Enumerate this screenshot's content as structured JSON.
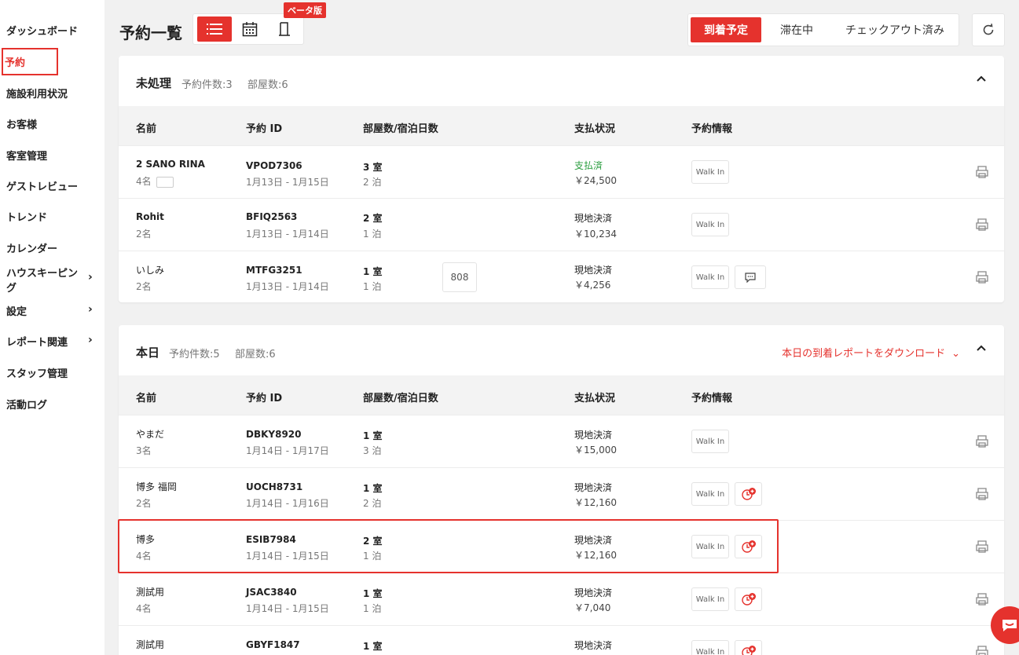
{
  "sidebar": {
    "items": [
      {
        "label": "ダッシュボード"
      },
      {
        "label": "予約"
      },
      {
        "label": "施設利用状況"
      },
      {
        "label": "お客様"
      },
      {
        "label": "客室管理"
      },
      {
        "label": "ゲストレビュー"
      },
      {
        "label": "トレンド"
      },
      {
        "label": "カレンダー"
      },
      {
        "label": "ハウスキーピン",
        "label2": "グ"
      },
      {
        "label": "設定"
      },
      {
        "label": "レポート関連"
      },
      {
        "label": "スタッフ管理"
      },
      {
        "label": "活動ログ"
      }
    ]
  },
  "header": {
    "title": "予約一覧",
    "beta_badge": "ベータ版",
    "status_tabs": [
      "到着予定",
      "滞在中",
      "チェックアウト済み"
    ],
    "active_status_tab": "到着予定"
  },
  "columns": [
    "名前",
    "予約 ID",
    "部屋数/宿泊日数",
    "支払状況",
    "予約情報"
  ],
  "sections": [
    {
      "title": "未処理",
      "meta1": "予約件数:3",
      "meta2": "部屋数:6",
      "rows": [
        {
          "name": "2 SANO RINA",
          "guests": "4名",
          "id": "VPOD7306",
          "dates": "1月13日 - 1月15日",
          "rooms": "3 室",
          "nights": "2 泊",
          "pay_status": "支払済",
          "amount": "￥24,500",
          "info": "Walk In"
        },
        {
          "name": "Rohit",
          "guests": "2名",
          "id": "BFIQ2563",
          "dates": "1月13日 - 1月14日",
          "rooms": "2 室",
          "nights": "1 泊",
          "pay_status": "現地決済",
          "amount": "￥10,234",
          "info": "Walk In"
        },
        {
          "name": "いしみ",
          "guests": "2名",
          "id": "MTFG3251",
          "dates": "1月13日 - 1月14日",
          "rooms": "1 室",
          "nights": "1 泊",
          "room_no": "808",
          "pay_status": "現地決済",
          "amount": "￥4,256",
          "info": "Walk In"
        }
      ]
    },
    {
      "title": "本日",
      "meta1": "予約件数:5",
      "meta2": "部屋数:6",
      "download": "本日の到着レポートをダウンロード",
      "rows": [
        {
          "name": "やまだ",
          "guests": "3名",
          "id": "DBKY8920",
          "dates": "1月14日 - 1月17日",
          "rooms": "1 室",
          "nights": "3 泊",
          "pay_status": "現地決済",
          "amount": "￥15,000",
          "info": "Walk In"
        },
        {
          "name": "博多 福岡",
          "guests": "2名",
          "id": "UOCH8731",
          "dates": "1月14日 - 1月16日",
          "rooms": "1 室",
          "nights": "2 泊",
          "pay_status": "現地決済",
          "amount": "￥12,160",
          "info": "Walk In"
        },
        {
          "name": "博多",
          "guests": "4名",
          "id": "ESIB7984",
          "dates": "1月14日 - 1月15日",
          "rooms": "2 室",
          "nights": "1 泊",
          "pay_status": "現地決済",
          "amount": "￥12,160",
          "info": "Walk In"
        },
        {
          "name": "測試用",
          "guests": "4名",
          "id": "JSAC3840",
          "dates": "1月14日 - 1月15日",
          "rooms": "1 室",
          "nights": "1 泊",
          "pay_status": "現地決済",
          "amount": "￥7,040",
          "info": "Walk In"
        },
        {
          "name": "測試用",
          "id": "GBYF1847",
          "rooms": "1 室",
          "pay_status": "現地決済",
          "info": "Walk In"
        }
      ]
    }
  ],
  "colors": {
    "accent": "#e5322d",
    "paid": "#2a9d3f"
  }
}
